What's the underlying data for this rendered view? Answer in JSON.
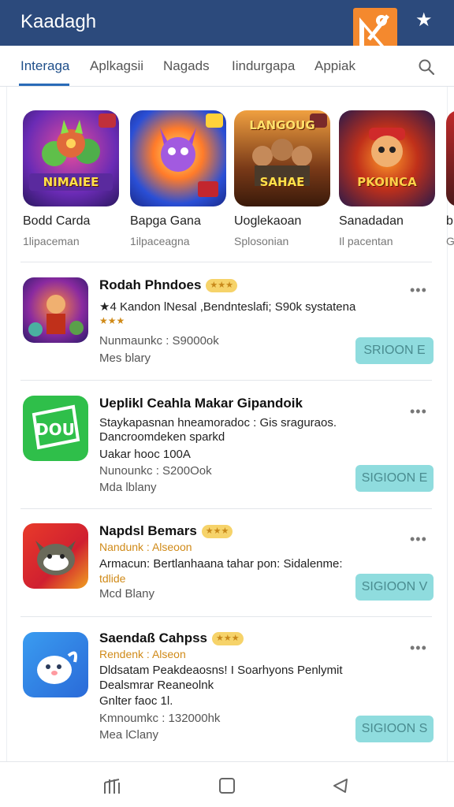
{
  "header": {
    "title": "Kaadagh",
    "star_icon": "star-icon",
    "logo_icon": "app-logo-icon"
  },
  "tabs": [
    {
      "label": "Interaga",
      "active": true
    },
    {
      "label": "Aplkagsii",
      "active": false
    },
    {
      "label": "Nagads",
      "active": false
    },
    {
      "label": "Iindurgapa",
      "active": false
    },
    {
      "label": "Appiak",
      "active": false
    }
  ],
  "search_icon": "search-icon",
  "carousel": [
    {
      "name": "Bodd Carda",
      "sub": "1lipaceman",
      "banner": "NIMAIEE"
    },
    {
      "name": "Bapga Gana",
      "sub": "1ilpaceagna",
      "banner": ""
    },
    {
      "name": "Uoglekaoan",
      "sub": "Splosonian",
      "banner": "SAHAE"
    },
    {
      "name": "Sanadadan",
      "sub": "Il pacentan",
      "banner": "PKOINCA"
    },
    {
      "name": "b",
      "sub": "G",
      "banner": ""
    }
  ],
  "items": [
    {
      "name": "Rodah Phndoes",
      "rating": "★★★",
      "lines": [
        {
          "text": "★4 Kandon lNesal ,Bendnteslafi; S90k systatena",
          "style": "normal"
        },
        {
          "text": "★★★",
          "style": "gold"
        },
        {
          "text": "Nunmaunkc : S9000ok",
          "style": "muted"
        },
        {
          "text": "Mes blary",
          "style": "muted"
        }
      ],
      "button": "SRIOON E"
    },
    {
      "name": "Ueplikl Ceahla Makar Gipandoik",
      "rating": "",
      "lines": [
        {
          "text": "Staykapasnan hneamoradoc : Gis sraguraos.",
          "style": "normal"
        },
        {
          "text": "Dancroomdeken sparkd",
          "style": "normal"
        },
        {
          "text": "Uakar hooc 100A",
          "style": "normal"
        },
        {
          "text": "Nunounkc : S200Ook",
          "style": "muted"
        },
        {
          "text": "Mda lblany",
          "style": "muted"
        }
      ],
      "button": "SIGIOON E"
    },
    {
      "name": "Napdsl Bemars",
      "rating": "★★★",
      "lines": [
        {
          "text": "Nandunk : Alseoon",
          "style": "gold"
        },
        {
          "text": "Armacun: Bertlanhaana tahar pon: Sidalenme:",
          "style": "normal"
        },
        {
          "text": "tdlide",
          "style": "gold"
        },
        {
          "text": "Mcd Blany",
          "style": "muted"
        }
      ],
      "button": "SIGIOON V"
    },
    {
      "name": "Saendaß Cahpss",
      "rating": "★★★",
      "lines": [
        {
          "text": "Rendenk : Alseon",
          "style": "gold"
        },
        {
          "text": "Dldsatam Peakdeaosns! I Soarhyons Penlymit",
          "style": "normal"
        },
        {
          "text": "Dealsmrar Reaneolnk",
          "style": "normal"
        },
        {
          "text": "Gnlter faoc 1l.",
          "style": "normal"
        },
        {
          "text": "Kmnoumkc : 132000hk",
          "style": "muted"
        },
        {
          "text": "Mea lClany",
          "style": "muted"
        }
      ],
      "button": "SIGIOON S"
    }
  ],
  "bottom_nav": [
    {
      "icon": "recent-apps-icon"
    },
    {
      "icon": "home-icon"
    },
    {
      "icon": "back-icon"
    }
  ],
  "colors": {
    "header": "#2c4a7c",
    "accent": "#2a6bb8",
    "button": "#8fdcde",
    "logo": "#f4892e"
  }
}
